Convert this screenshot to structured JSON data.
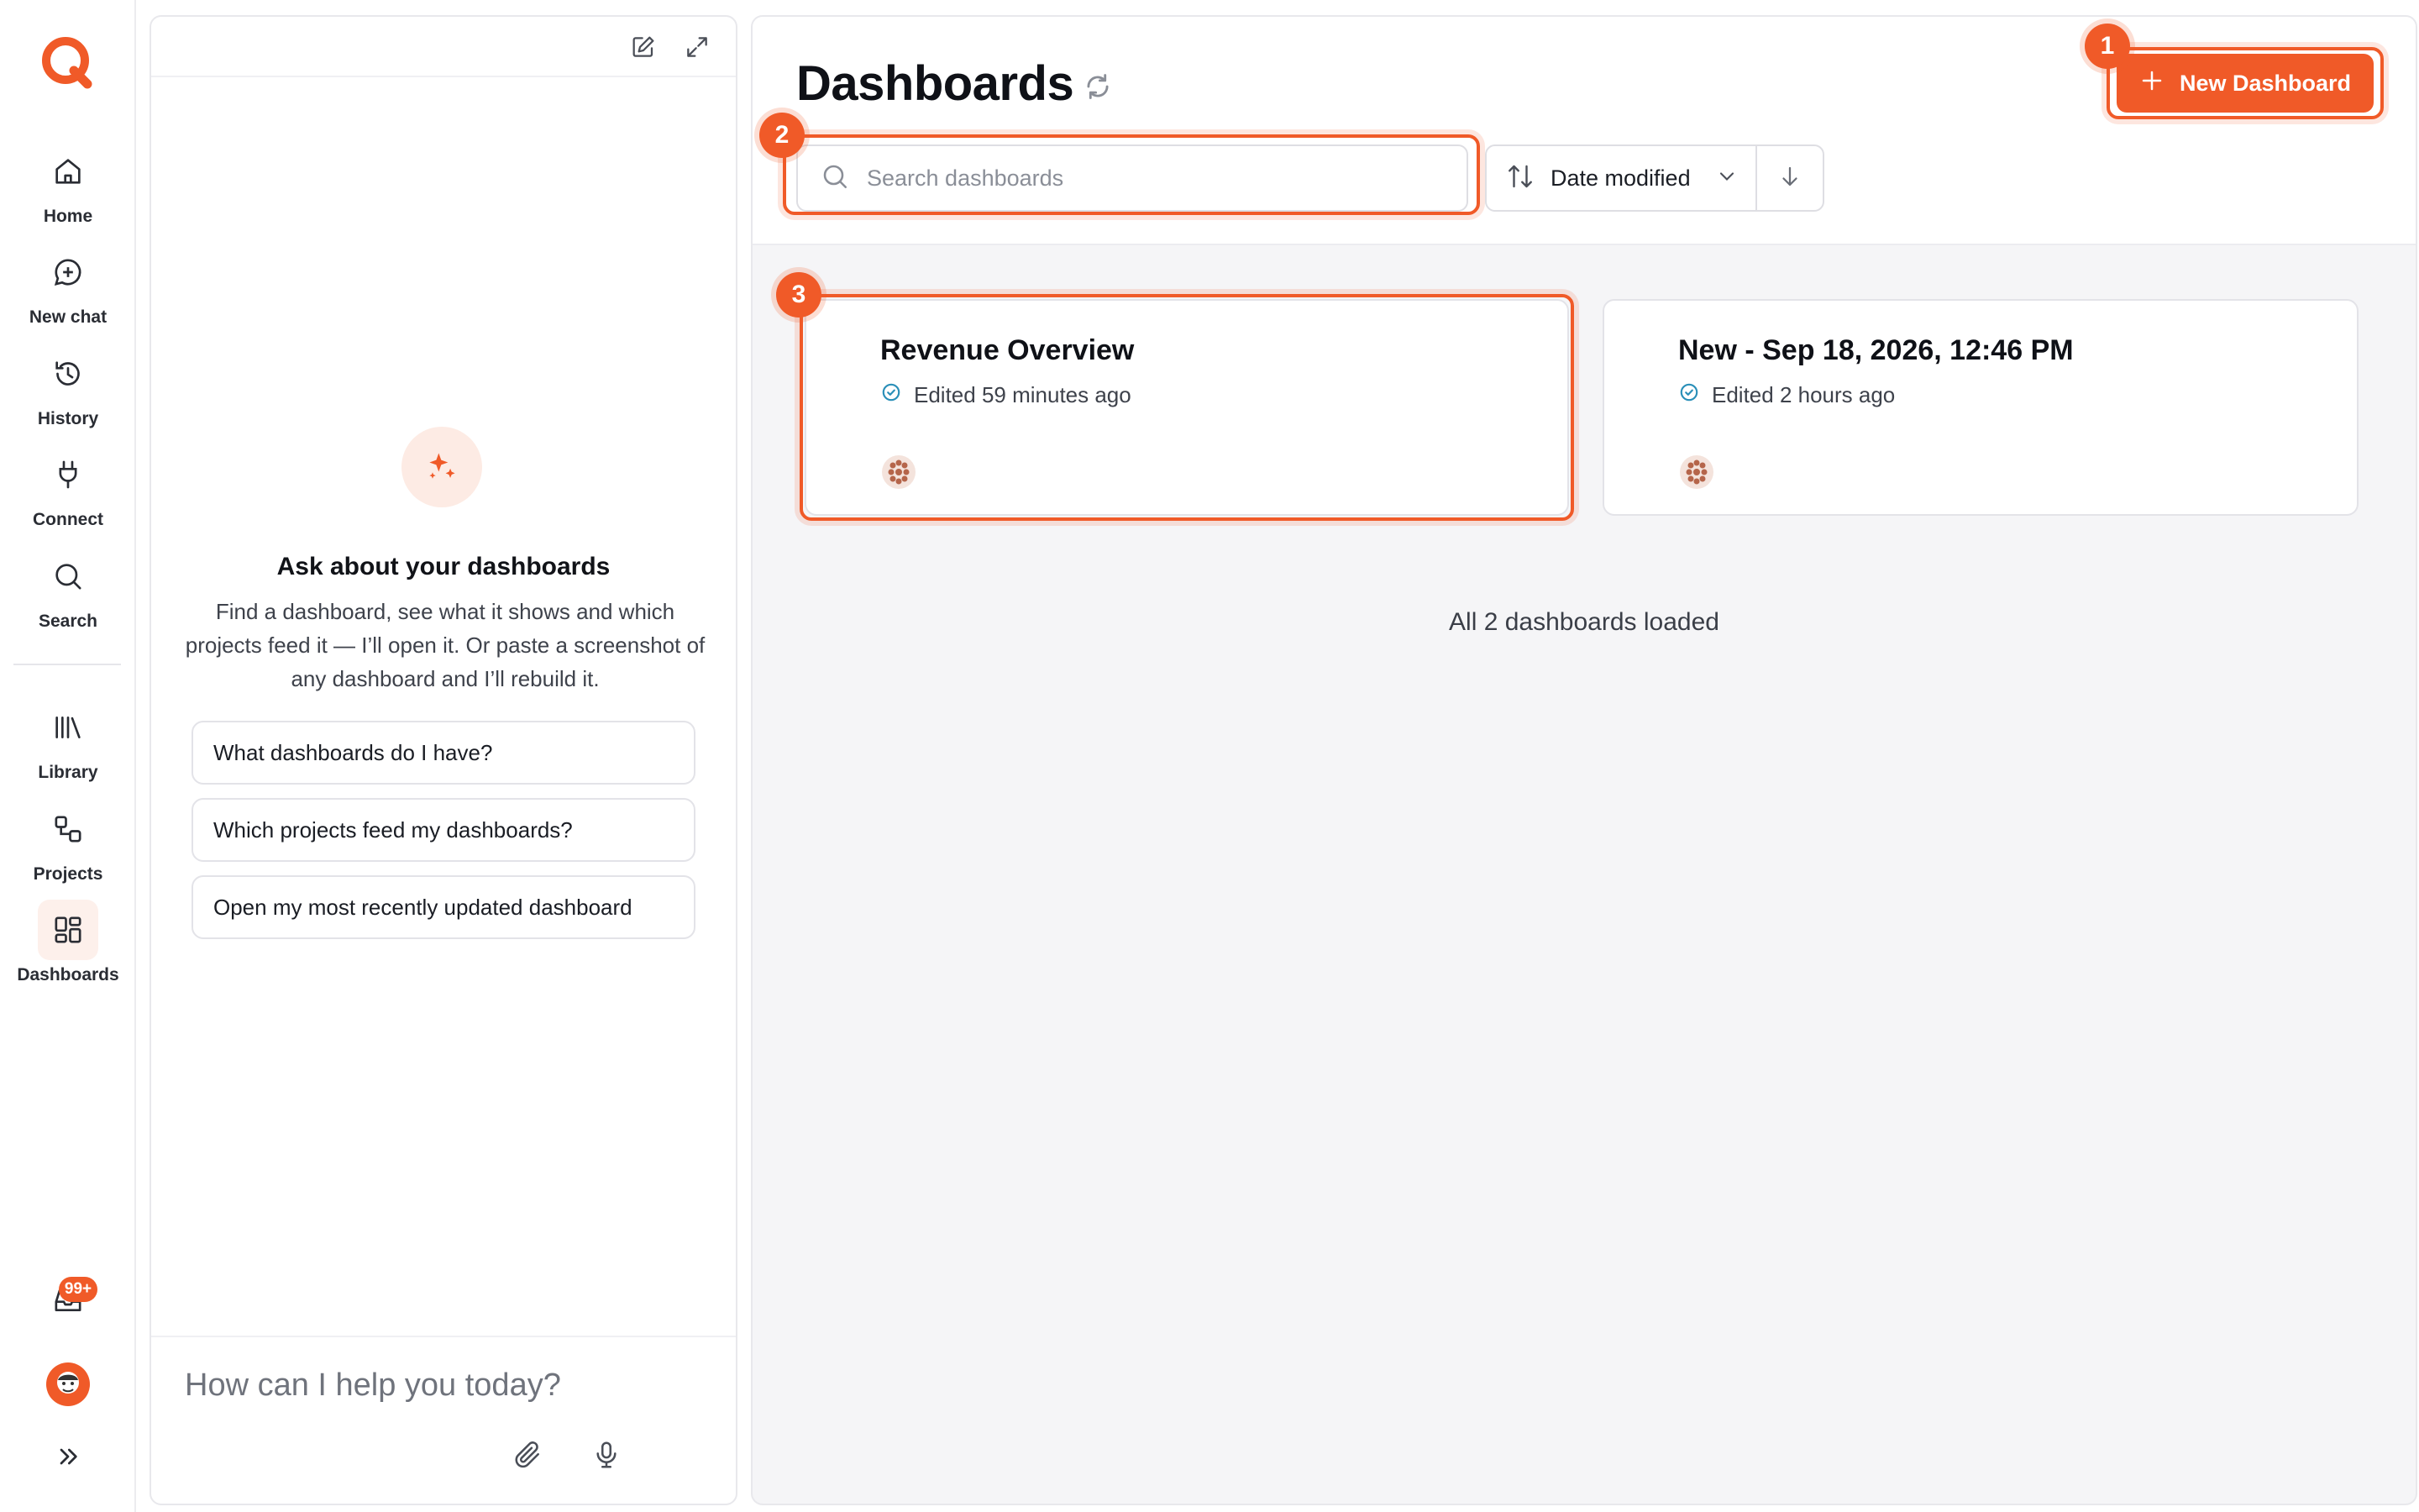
{
  "colors": {
    "accent": "#f05a28",
    "accent_soft": "#fdebe4",
    "verified": "#2a8fb8"
  },
  "sidebar": {
    "logo": "q-logo-icon",
    "items": [
      {
        "label": "Home",
        "icon": "home-icon"
      },
      {
        "label": "New chat",
        "icon": "chat-plus-icon"
      },
      {
        "label": "History",
        "icon": "history-icon"
      },
      {
        "label": "Connect",
        "icon": "plug-icon"
      },
      {
        "label": "Search",
        "icon": "search-icon"
      },
      {
        "label": "Library",
        "icon": "library-icon"
      },
      {
        "label": "Projects",
        "icon": "projects-icon"
      },
      {
        "label": "Dashboards",
        "icon": "dashboards-icon",
        "active": true
      }
    ],
    "inbox_badge": "99+"
  },
  "chat": {
    "heading": "Ask about your dashboards",
    "description": "Find a dashboard, see what it shows and which projects feed it — I’ll open it. Or paste a screenshot of any dashboard and I’ll rebuild it.",
    "suggestions": [
      "What dashboards do I have?",
      "Which projects feed my dashboards?",
      "Open my most recently updated dashboard"
    ],
    "composer_placeholder": "How can I help you today?"
  },
  "main": {
    "title": "Dashboards",
    "new_button": "New Dashboard",
    "search_placeholder": "Search dashboards",
    "sort_label": "Date modified",
    "markers": [
      "1",
      "2",
      "3"
    ],
    "cards": [
      {
        "title": "Revenue Overview",
        "meta": "Edited 59 minutes ago"
      },
      {
        "title": "New - Sep 18, 2026, 12:46 PM",
        "meta": "Edited 2 hours ago"
      }
    ],
    "status": "All 2 dashboards loaded"
  }
}
